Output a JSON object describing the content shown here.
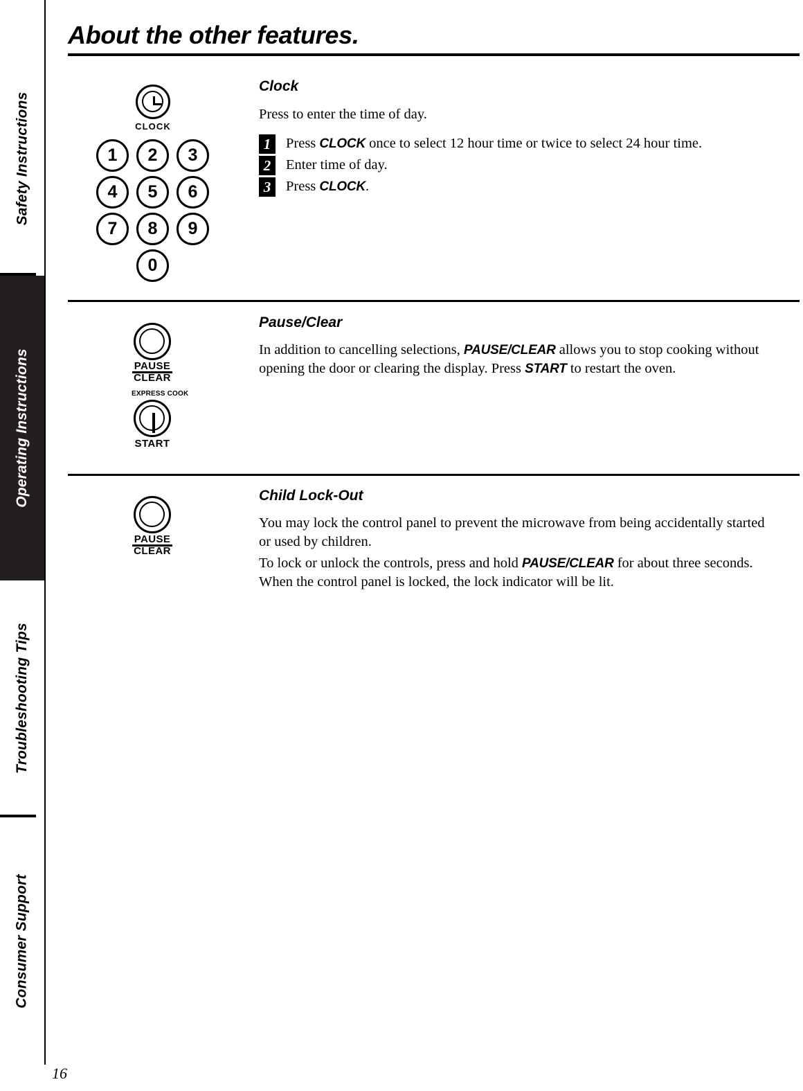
{
  "page": {
    "title": "About the other features.",
    "number": "16"
  },
  "sidebar": {
    "items": [
      {
        "label": "Safety Instructions",
        "active": false
      },
      {
        "label": "Operating Instructions",
        "active": true
      },
      {
        "label": "Troubleshooting Tips",
        "active": false
      },
      {
        "label": "Consumer Support",
        "active": false
      }
    ]
  },
  "keypad": {
    "clock_caption": "CLOCK",
    "keys": [
      "1",
      "2",
      "3",
      "4",
      "5",
      "6",
      "7",
      "8",
      "9",
      "0"
    ]
  },
  "pause_art": {
    "pause_label": "PAUSE",
    "clear_label": "CLEAR",
    "express_label": "EXPRESS COOK",
    "start_label": "START"
  },
  "lock_art": {
    "pause_label": "PAUSE",
    "clear_label": "CLEAR"
  },
  "sections": {
    "clock": {
      "heading": "Clock",
      "intro": "Press to enter the time of day.",
      "steps": [
        {
          "num": "1",
          "pre": "Press ",
          "strong": "CLOCK",
          "post": " once to select 12 hour time or twice to select 24 hour time."
        },
        {
          "num": "2",
          "pre": "Enter time of day.",
          "strong": "",
          "post": ""
        },
        {
          "num": "3",
          "pre": "Press ",
          "strong": "CLOCK",
          "post": "."
        }
      ]
    },
    "pause_clear": {
      "heading": "Pause/Clear",
      "body_1": "In addition to cancelling selections, ",
      "body_strong_1": "PAUSE/CLEAR",
      "body_2": " allows you to stop cooking without opening the door or clearing the display. Press ",
      "body_strong_2": "START",
      "body_3": " to restart the oven."
    },
    "child_lock": {
      "heading": "Child Lock-Out",
      "para_1": "You may lock the control panel to prevent the microwave from being accidentally started or used by children.",
      "para_2_pre": "To lock or unlock the controls, press and hold ",
      "para_2_strong": "PAUSE/CLEAR",
      "para_2_post": " for about three seconds. When the control panel is locked, the lock indicator will be lit."
    }
  }
}
